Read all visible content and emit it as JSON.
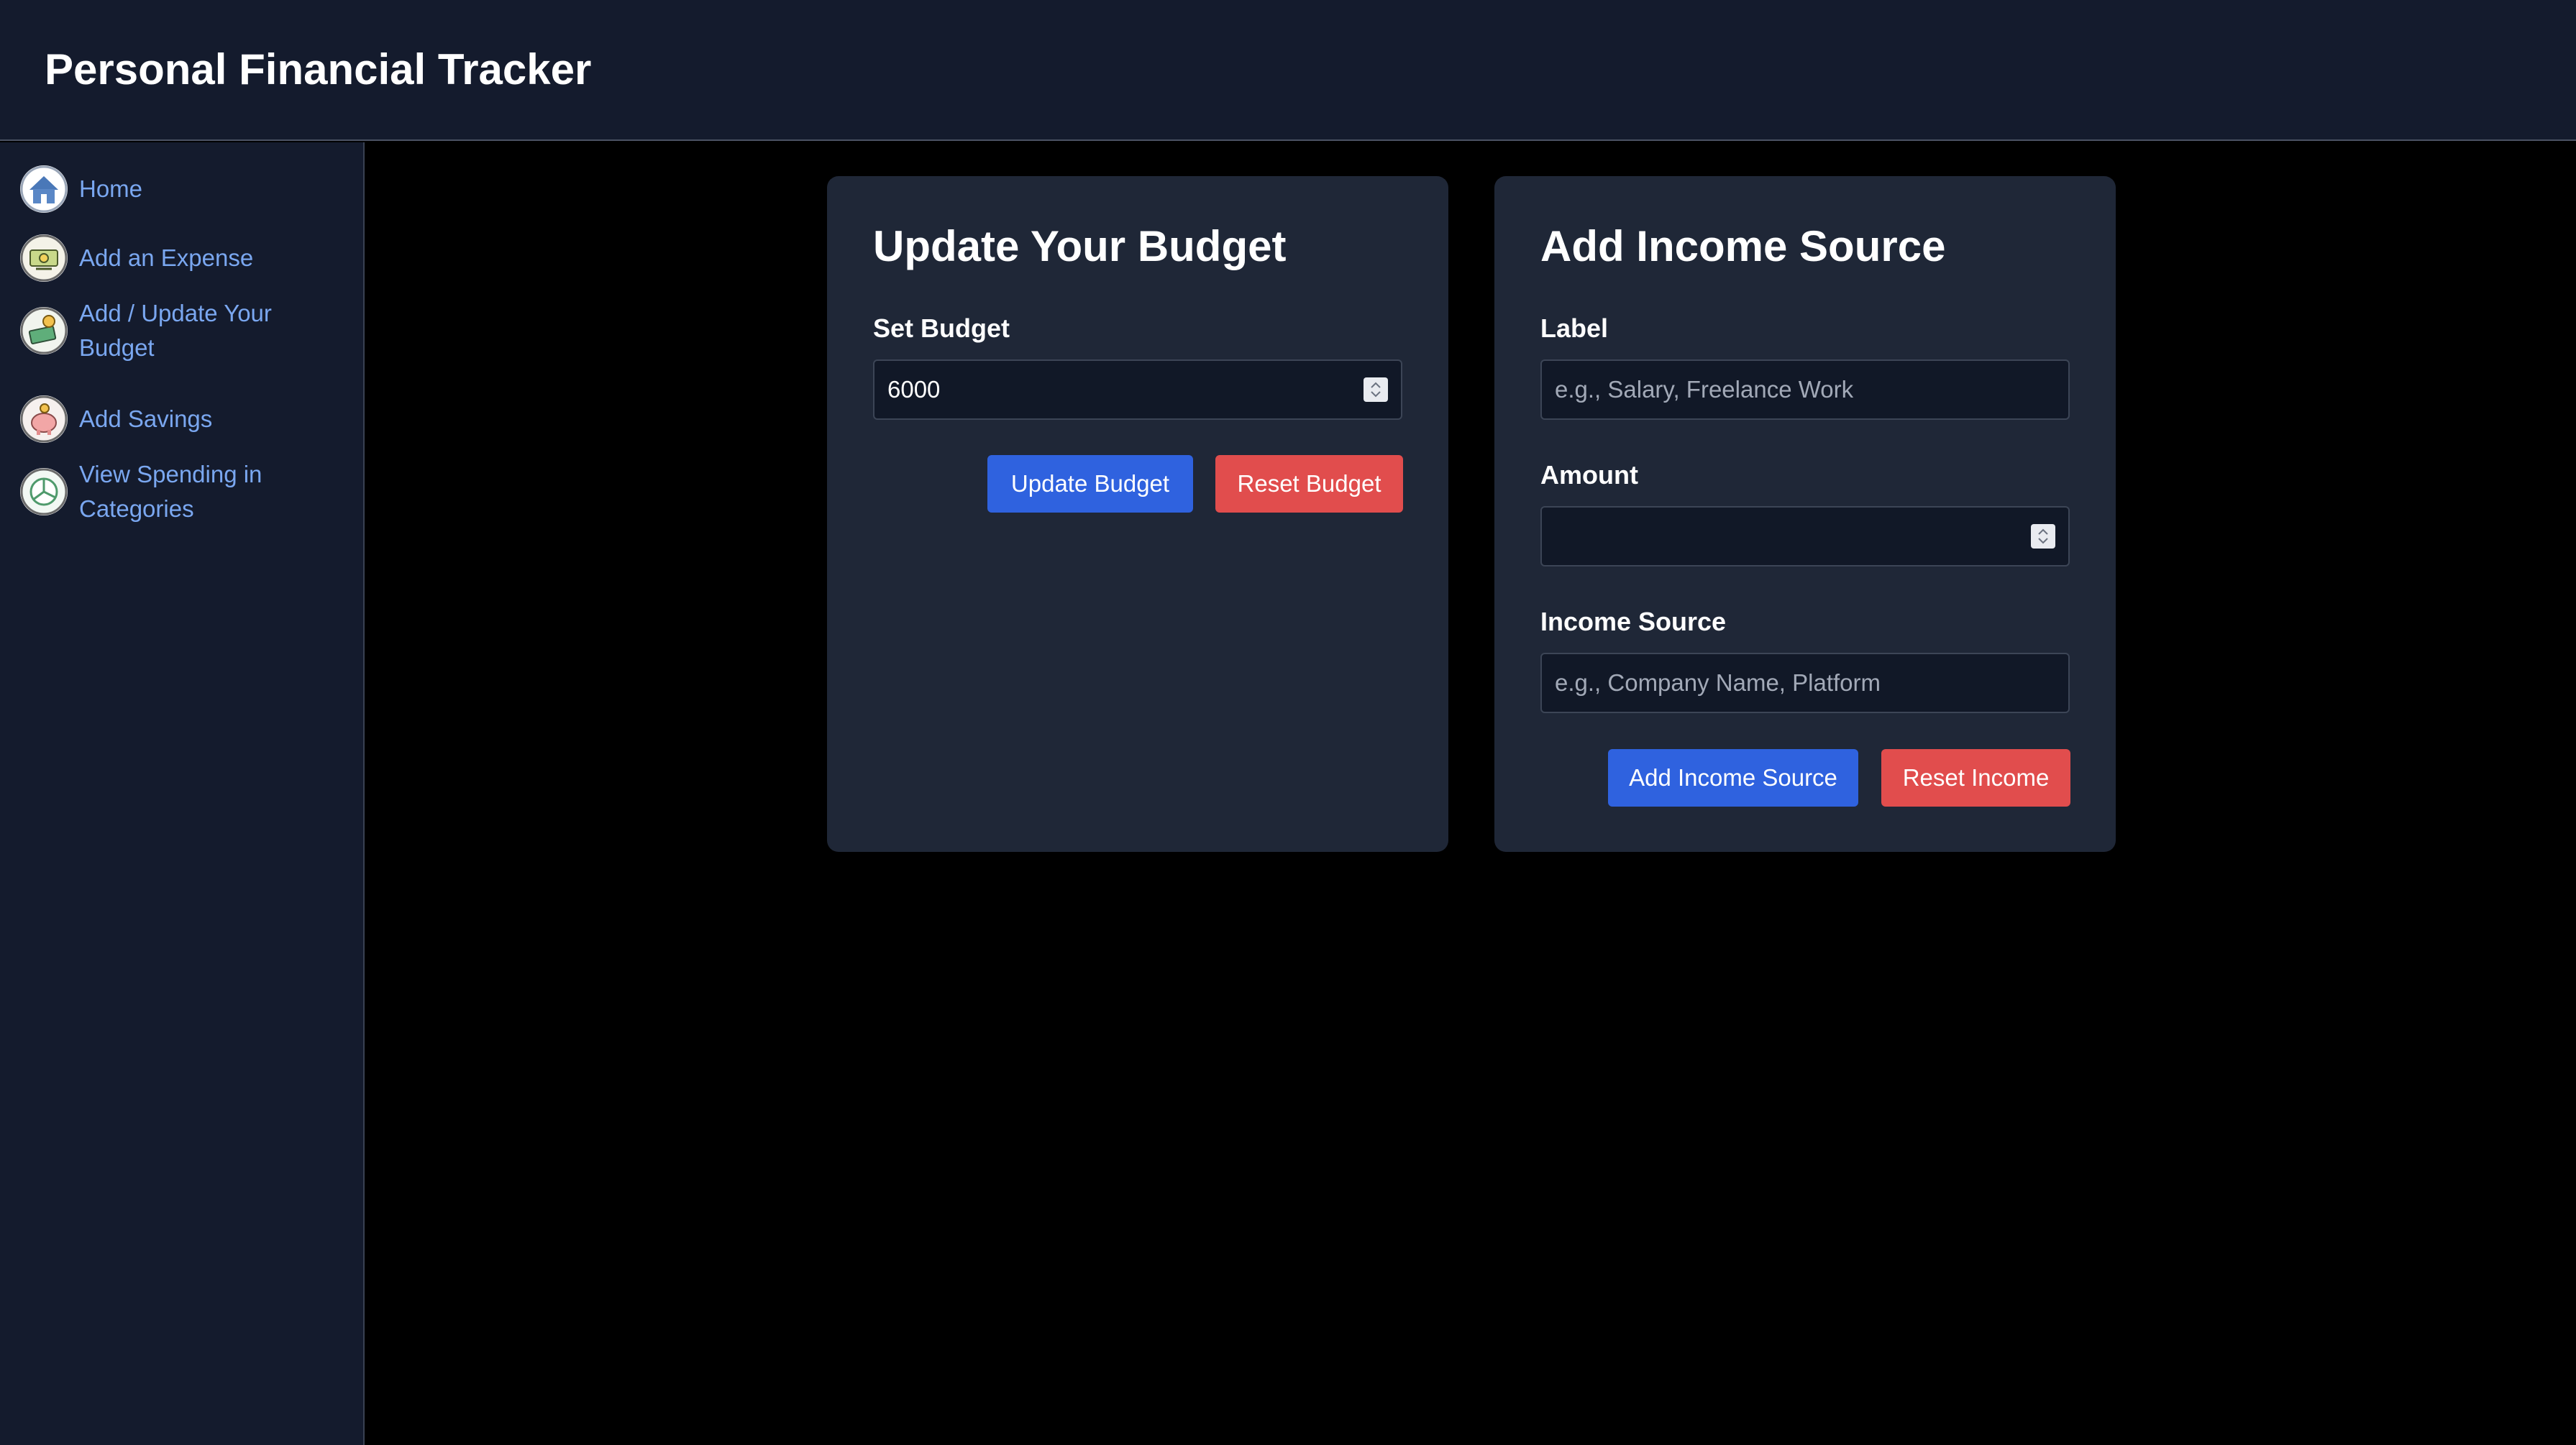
{
  "app": {
    "title": "Personal Financial Tracker"
  },
  "sidebar": {
    "items": [
      {
        "label": "Home",
        "icon": "home-icon"
      },
      {
        "label": "Add an Expense",
        "icon": "money-icon"
      },
      {
        "label": "Add / Update Your Budget",
        "icon": "budget-icon"
      },
      {
        "label": "Add Savings",
        "icon": "piggy-bank-icon"
      },
      {
        "label": "View Spending in Categories",
        "icon": "pie-chart-icon"
      }
    ]
  },
  "budget_card": {
    "title": "Update Your Budget",
    "field_label": "Set Budget",
    "value": "6000",
    "update_button": "Update Budget",
    "reset_button": "Reset Budget"
  },
  "income_card": {
    "title": "Add Income Source",
    "label_field": {
      "label": "Label",
      "value": "",
      "placeholder": "e.g., Salary, Freelance Work"
    },
    "amount_field": {
      "label": "Amount",
      "value": "",
      "placeholder": ""
    },
    "source_field": {
      "label": "Income Source",
      "value": "",
      "placeholder": "e.g., Company Name, Platform"
    },
    "add_button": "Add Income Source",
    "reset_button": "Reset Income"
  },
  "colors": {
    "header_bg": "#141b2d",
    "sidebar_bg": "#141b2d",
    "main_bg": "#000000",
    "card_bg": "#1f2737",
    "link": "#7aa7f0",
    "primary_button": "#2f62df",
    "danger_button": "#e14d4d"
  }
}
